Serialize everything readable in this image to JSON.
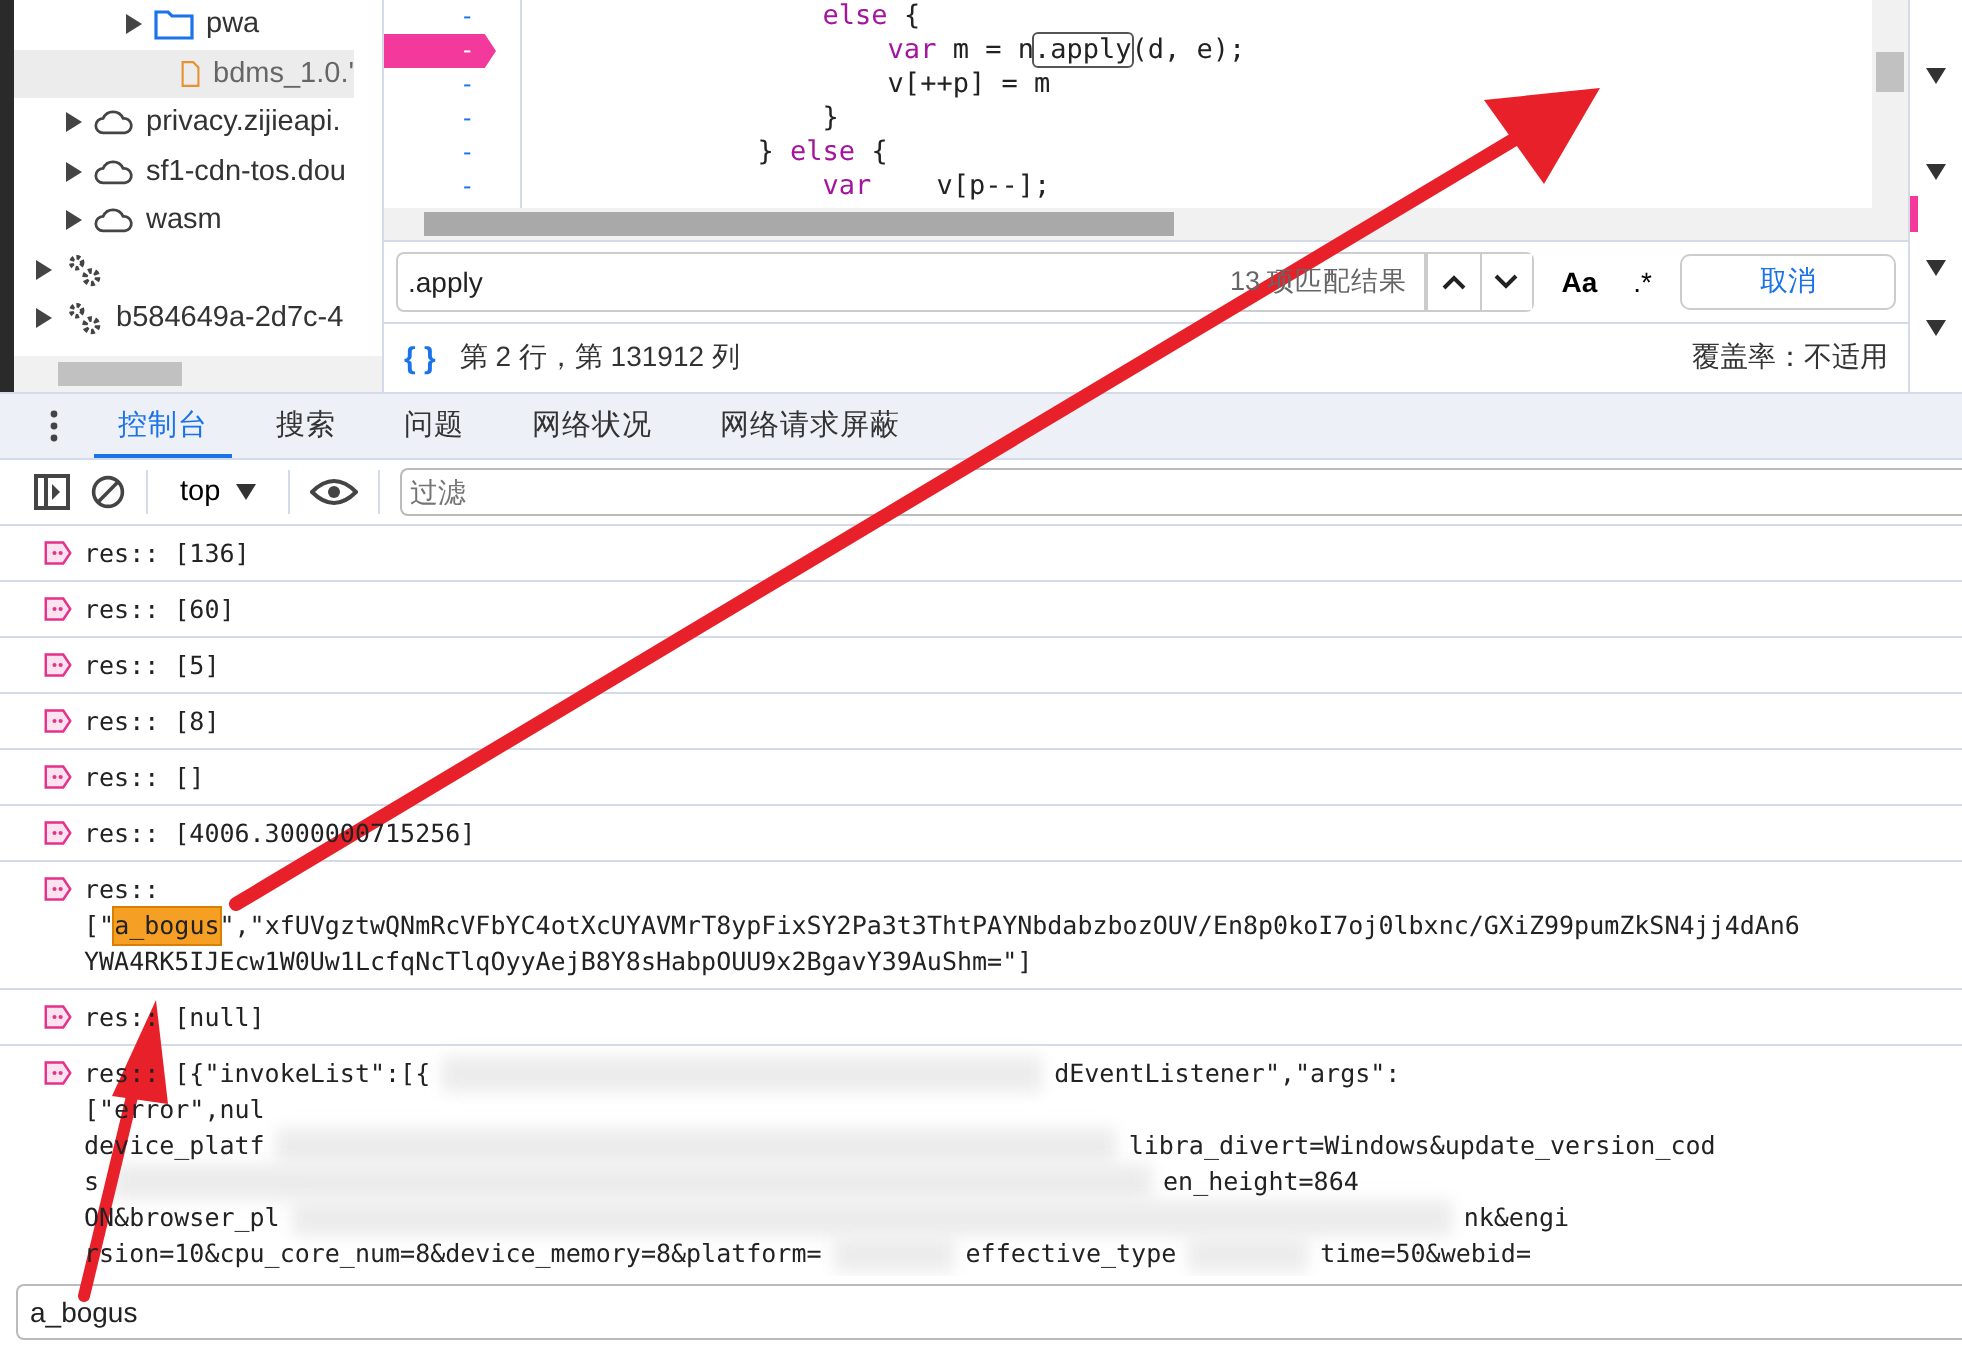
{
  "file_tree": [
    {
      "kind": "folder",
      "label": "pwa",
      "selected": false
    },
    {
      "kind": "file",
      "label": "bdms_1.0.'",
      "selected": true
    },
    {
      "kind": "cloud",
      "label": "privacy.zijieapi.",
      "selected": false
    },
    {
      "kind": "cloud",
      "label": "sf1-cdn-tos.dou",
      "selected": false
    },
    {
      "kind": "cloud",
      "label": "wasm",
      "selected": false
    },
    {
      "kind": "worker",
      "selected": false
    },
    {
      "kind": "worker",
      "label": "b584649a-2d7c-4",
      "selected": false
    }
  ],
  "gutter": [
    {
      "text": "-",
      "breakpoint": false
    },
    {
      "text": "-",
      "breakpoint": true
    },
    {
      "text": "-",
      "breakpoint": false
    },
    {
      "text": "-",
      "breakpoint": false
    },
    {
      "text": "-",
      "breakpoint": false
    },
    {
      "text": "-",
      "breakpoint": false
    }
  ],
  "code_lines": [
    [
      {
        "kind": "keyword",
        "text": "                  else"
      },
      {
        "kind": "plain",
        "text": " {"
      }
    ],
    [
      {
        "kind": "keyword",
        "text": "                      var"
      },
      {
        "kind": "plain",
        "text": " m = n"
      },
      {
        "kind": "match",
        "text": ".apply"
      },
      {
        "kind": "plain",
        "text": "(d, e);"
      }
    ],
    [
      {
        "kind": "plain",
        "text": "                      v[++p] = m"
      }
    ],
    [
      {
        "kind": "plain",
        "text": "                  }"
      }
    ],
    [
      {
        "kind": "plain",
        "text": "              } "
      },
      {
        "kind": "keyword",
        "text": "else"
      },
      {
        "kind": "plain",
        "text": " {"
      }
    ],
    [
      {
        "kind": "keyword",
        "text": "                  var"
      },
      {
        "kind": "plain",
        "text": "    v[p--];"
      }
    ]
  ],
  "search": {
    "value": ".apply",
    "match_count": "13 项匹配结果",
    "case_button": "Aa",
    "regex_button": ".*",
    "cancel": "取消"
  },
  "status": {
    "format_button": "{ }",
    "position": "第 2 行，第 131912 列",
    "coverage": "覆盖率：不适用"
  },
  "tabs": [
    {
      "label": "控制台",
      "selected": true
    },
    {
      "label": "搜索",
      "selected": false
    },
    {
      "label": "问题",
      "selected": false
    },
    {
      "label": "网络状况",
      "selected": false
    },
    {
      "label": "网络请求屏蔽",
      "selected": false
    }
  ],
  "toolbar": {
    "context": "top",
    "filter_placeholder": "过滤"
  },
  "logs": [
    {
      "kind": "plain",
      "lines": [
        [
          {
            "text": "res:: [136]"
          }
        ]
      ]
    },
    {
      "kind": "plain",
      "lines": [
        [
          {
            "text": "res:: [60]"
          }
        ]
      ]
    },
    {
      "kind": "plain",
      "lines": [
        [
          {
            "text": "res:: [5]"
          }
        ]
      ]
    },
    {
      "kind": "plain",
      "lines": [
        [
          {
            "text": "res:: [8]"
          }
        ]
      ]
    },
    {
      "kind": "plain",
      "lines": [
        [
          {
            "text": "res:: []"
          }
        ]
      ]
    },
    {
      "kind": "plain",
      "lines": [
        [
          {
            "text": "res:: [4006.3000000715256]"
          }
        ]
      ]
    },
    {
      "kind": "plain",
      "lines": [
        [
          {
            "text": "res::"
          }
        ],
        [
          {
            "text": "[\""
          },
          {
            "text": "a_bogus",
            "highlight": true
          },
          {
            "text": "\",\"xfUVgztwQNmRcVFbYC4otXcUYAVMrT8ypFixSY2Pa3t3ThtPAYNbdabzbozOUV/En8p0koI7oj0lbxnc/GXiZ99pumZkSN4jj4dAn6"
          }
        ],
        [
          {
            "text": "YWA4RK5IJEcw1W0Uw1LcfqNcTlqOyyAejB8Y8sHabpOUU9x2BgavY39AuShm=\"]"
          }
        ]
      ]
    },
    {
      "kind": "plain",
      "lines": [
        [
          {
            "text": "res:: [null]"
          }
        ]
      ]
    },
    {
      "kind": "redacted",
      "lines": [
        [
          {
            "text": "res:: [{\"invokeList\":[{"
          },
          {
            "text": "dEventListener\",\"args\":"
          }
        ],
        [
          {
            "text": "[\"error\",nul"
          }
        ],
        [
          {
            "text": "device_platf"
          },
          {
            "text": "libra_divert=Windows&update_version_cod"
          }
        ],
        [
          {
            "text": "s"
          },
          {
            "text": "en_height=864"
          }
        ],
        [
          {
            "text": "ON&browser_pl"
          },
          {
            "text": "nk&engi"
          }
        ],
        [
          {
            "text": "rsion=10&cpu_core_num=8&device_memory=8&platform="
          },
          {
            "text": "effective_type"
          },
          {
            "text": "time=50&webid="
          }
        ]
      ]
    }
  ],
  "console_input": {
    "value": "a_bogus"
  }
}
